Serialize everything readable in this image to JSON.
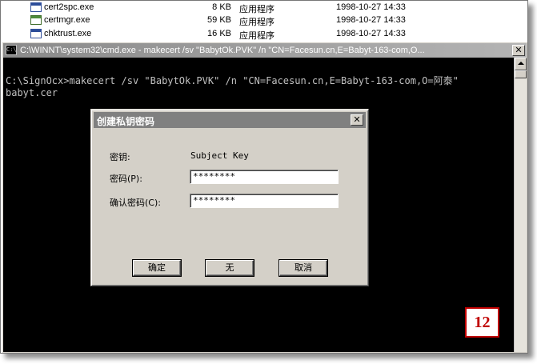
{
  "files": [
    {
      "name": "cert2spc.exe",
      "size": "8 KB",
      "type": "应用程序",
      "date": "1998-10-27 14:33",
      "icon": "exe-icon"
    },
    {
      "name": "certmgr.exe",
      "size": "59 KB",
      "type": "应用程序",
      "date": "1998-10-27 14:33",
      "icon": "certificate-exe-icon"
    },
    {
      "name": "chktrust.exe",
      "size": "16 KB",
      "type": "应用程序",
      "date": "1998-10-27 14:33",
      "icon": "exe-icon"
    }
  ],
  "cmd": {
    "title": "C:\\WINNT\\system32\\cmd.exe - makecert /sv \"BabytOk.PVK\" /n \"CN=Facesun.cn,E=Babyt-163-com,O...",
    "icon_label": "C:\\",
    "close_label": "✕",
    "line1": "C:\\SignOcx>makecert /sv \"BabytOk.PVK\" /n \"CN=Facesun.cn,E=Babyt-163-com,O=阿泰\"",
    "line2": "babyt.cer"
  },
  "dialog": {
    "title": "创建私钥密码",
    "close_label": "✕",
    "key_label": "密钥:",
    "key_value": "Subject Key",
    "password_label": "密码(P):",
    "password_value": "********",
    "confirm_label": "确认密码(C):",
    "confirm_value": "********",
    "ok_label": "确定",
    "none_label": "无",
    "cancel_label": "取消"
  },
  "badge": {
    "number": "12"
  },
  "colors": {
    "badge_red": "#c00000",
    "console_bg": "#000000",
    "console_text": "#c0c0c0",
    "dialog_face": "#d4d0c8"
  }
}
